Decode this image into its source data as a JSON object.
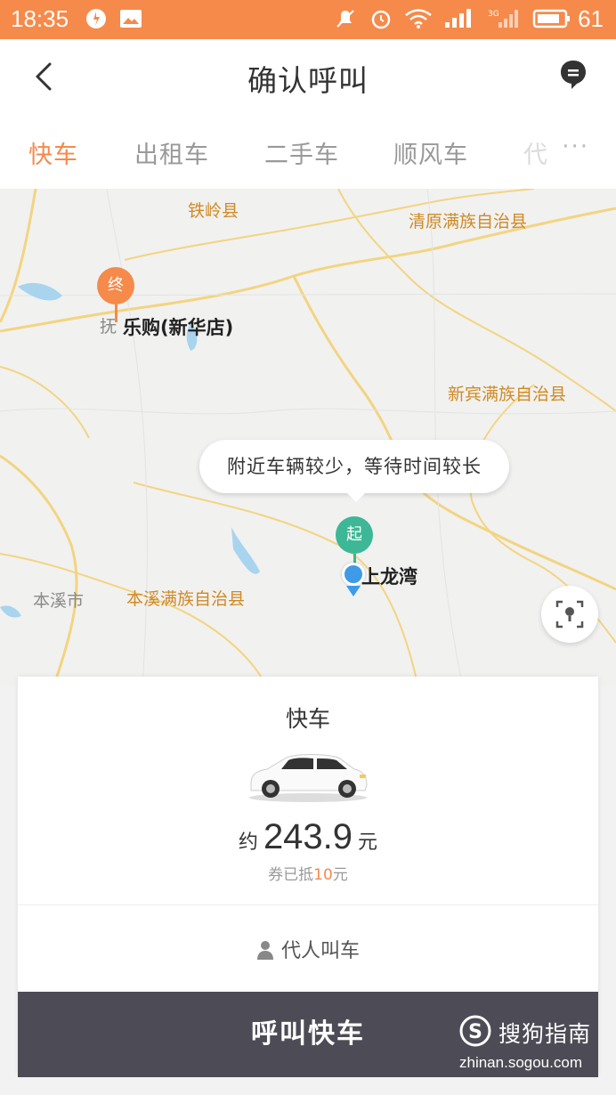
{
  "status_bar": {
    "time": "18:35",
    "battery": "61"
  },
  "header": {
    "title": "确认呼叫"
  },
  "tabs": [
    {
      "label": "快车",
      "active": true
    },
    {
      "label": "出租车",
      "active": false
    },
    {
      "label": "二手车",
      "active": false
    },
    {
      "label": "顺风车",
      "active": false
    },
    {
      "label": "代",
      "active": false
    }
  ],
  "tabs_more": "···",
  "map": {
    "labels": {
      "tieling": "铁岭县",
      "qingyuan": "清原满族自治县",
      "xinbin": "新宾满族自治县",
      "benxi_city": "本溪市",
      "benxi_county": "本溪满族自治县",
      "fushun_partial": "抚",
      "destination": "乐购(新华店)",
      "origin": "上龙湾"
    },
    "pins": {
      "end": "终",
      "start": "起"
    },
    "tooltip": "附近车辆较少，等待时间较长"
  },
  "card": {
    "title": "快车",
    "price_prefix": "约",
    "price": "243.9",
    "price_unit": "元",
    "coupon_prefix": "券已抵",
    "coupon_amount": "10",
    "coupon_unit": "元",
    "proxy_label": "代人叫车"
  },
  "call_button": "呼叫快车",
  "watermark": {
    "brand": "搜狗指南",
    "url": "zhinan.sogou.com"
  },
  "colors": {
    "accent": "#f58a4b",
    "start_pin": "#3db795",
    "location_dot": "#3f9ae8",
    "button": "#4d4b55"
  }
}
